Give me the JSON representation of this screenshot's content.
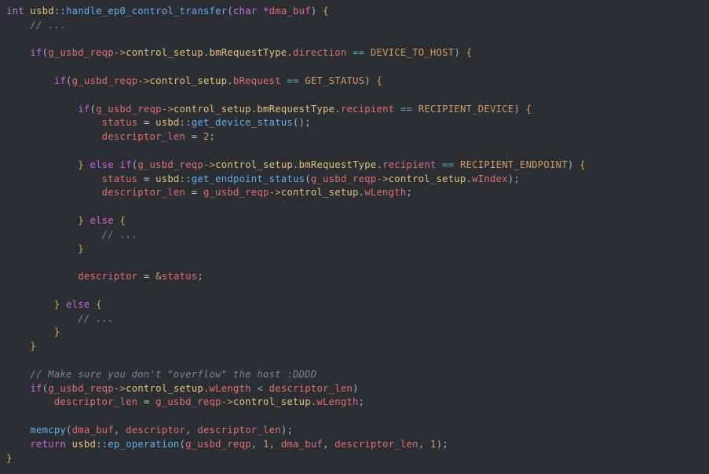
{
  "code": {
    "lines": [
      [
        {
          "t": "int",
          "c": "kw-type"
        },
        {
          "t": " ",
          "c": "op"
        },
        {
          "t": "usbd",
          "c": "ns"
        },
        {
          "t": "::",
          "c": "punct"
        },
        {
          "t": "handle_ep0_control_transfer",
          "c": "fn"
        },
        {
          "t": "(",
          "c": "punct"
        },
        {
          "t": "char",
          "c": "kw-type"
        },
        {
          "t": " ",
          "c": "op"
        },
        {
          "t": "*",
          "c": "op-star"
        },
        {
          "t": "dma_buf",
          "c": "param"
        },
        {
          "t": ")",
          "c": "punct"
        },
        {
          "t": " ",
          "c": "op"
        },
        {
          "t": "{",
          "c": "brace"
        }
      ],
      [
        {
          "t": "    ",
          "c": "op"
        },
        {
          "t": "// ...",
          "c": "comment"
        }
      ],
      [
        {
          "t": "",
          "c": "op"
        }
      ],
      [
        {
          "t": "    ",
          "c": "op"
        },
        {
          "t": "if",
          "c": "kw-ctrl"
        },
        {
          "t": "(",
          "c": "punct"
        },
        {
          "t": "g_usbd_reqp",
          "c": "var"
        },
        {
          "t": "->",
          "c": "op-arrow"
        },
        {
          "t": "control_setup",
          "c": "field"
        },
        {
          "t": ".",
          "c": "punct"
        },
        {
          "t": "bmRequestType",
          "c": "field"
        },
        {
          "t": ".",
          "c": "punct"
        },
        {
          "t": "direction",
          "c": "leaf"
        },
        {
          "t": " ",
          "c": "op"
        },
        {
          "t": "==",
          "c": "op-cmp"
        },
        {
          "t": " ",
          "c": "op"
        },
        {
          "t": "DEVICE_TO_HOST",
          "c": "const"
        },
        {
          "t": ")",
          "c": "punct"
        },
        {
          "t": " ",
          "c": "op"
        },
        {
          "t": "{",
          "c": "brace"
        }
      ],
      [
        {
          "t": "",
          "c": "op"
        }
      ],
      [
        {
          "t": "        ",
          "c": "op"
        },
        {
          "t": "if",
          "c": "kw-ctrl"
        },
        {
          "t": "(",
          "c": "punct"
        },
        {
          "t": "g_usbd_reqp",
          "c": "var"
        },
        {
          "t": "->",
          "c": "op-arrow"
        },
        {
          "t": "control_setup",
          "c": "field"
        },
        {
          "t": ".",
          "c": "punct"
        },
        {
          "t": "bRequest",
          "c": "leaf"
        },
        {
          "t": " ",
          "c": "op"
        },
        {
          "t": "==",
          "c": "op-cmp"
        },
        {
          "t": " ",
          "c": "op"
        },
        {
          "t": "GET_STATUS",
          "c": "const"
        },
        {
          "t": ")",
          "c": "punct"
        },
        {
          "t": " ",
          "c": "op"
        },
        {
          "t": "{",
          "c": "brace"
        }
      ],
      [
        {
          "t": "",
          "c": "op"
        }
      ],
      [
        {
          "t": "            ",
          "c": "op"
        },
        {
          "t": "if",
          "c": "kw-ctrl"
        },
        {
          "t": "(",
          "c": "punct"
        },
        {
          "t": "g_usbd_reqp",
          "c": "var"
        },
        {
          "t": "->",
          "c": "op-arrow"
        },
        {
          "t": "control_setup",
          "c": "field"
        },
        {
          "t": ".",
          "c": "punct"
        },
        {
          "t": "bmRequestType",
          "c": "field"
        },
        {
          "t": ".",
          "c": "punct"
        },
        {
          "t": "recipient",
          "c": "leaf"
        },
        {
          "t": " ",
          "c": "op"
        },
        {
          "t": "==",
          "c": "op-cmp"
        },
        {
          "t": " ",
          "c": "op"
        },
        {
          "t": "RECIPIENT_DEVICE",
          "c": "const"
        },
        {
          "t": ")",
          "c": "punct"
        },
        {
          "t": " ",
          "c": "op"
        },
        {
          "t": "{",
          "c": "brace"
        }
      ],
      [
        {
          "t": "                ",
          "c": "op"
        },
        {
          "t": "status",
          "c": "var"
        },
        {
          "t": " ",
          "c": "op"
        },
        {
          "t": "=",
          "c": "op-assign"
        },
        {
          "t": " ",
          "c": "op"
        },
        {
          "t": "usbd",
          "c": "ns"
        },
        {
          "t": "::",
          "c": "punct"
        },
        {
          "t": "get_device_status",
          "c": "fn"
        },
        {
          "t": "()",
          "c": "punct"
        },
        {
          "t": ";",
          "c": "punct"
        }
      ],
      [
        {
          "t": "                ",
          "c": "op"
        },
        {
          "t": "descriptor_len",
          "c": "var"
        },
        {
          "t": " ",
          "c": "op"
        },
        {
          "t": "=",
          "c": "op-assign"
        },
        {
          "t": " ",
          "c": "op"
        },
        {
          "t": "2",
          "c": "num"
        },
        {
          "t": ";",
          "c": "punct"
        }
      ],
      [
        {
          "t": "",
          "c": "op"
        }
      ],
      [
        {
          "t": "            ",
          "c": "op"
        },
        {
          "t": "}",
          "c": "brace"
        },
        {
          "t": " ",
          "c": "op"
        },
        {
          "t": "else",
          "c": "kw-ctrl"
        },
        {
          "t": " ",
          "c": "op"
        },
        {
          "t": "if",
          "c": "kw-ctrl"
        },
        {
          "t": "(",
          "c": "punct"
        },
        {
          "t": "g_usbd_reqp",
          "c": "var"
        },
        {
          "t": "->",
          "c": "op-arrow"
        },
        {
          "t": "control_setup",
          "c": "field"
        },
        {
          "t": ".",
          "c": "punct"
        },
        {
          "t": "bmRequestType",
          "c": "field"
        },
        {
          "t": ".",
          "c": "punct"
        },
        {
          "t": "recipient",
          "c": "leaf"
        },
        {
          "t": " ",
          "c": "op"
        },
        {
          "t": "==",
          "c": "op-cmp"
        },
        {
          "t": " ",
          "c": "op"
        },
        {
          "t": "RECIPIENT_ENDPOINT",
          "c": "const"
        },
        {
          "t": ")",
          "c": "punct"
        },
        {
          "t": " ",
          "c": "op"
        },
        {
          "t": "{",
          "c": "brace"
        }
      ],
      [
        {
          "t": "                ",
          "c": "op"
        },
        {
          "t": "status",
          "c": "var"
        },
        {
          "t": " ",
          "c": "op"
        },
        {
          "t": "=",
          "c": "op-assign"
        },
        {
          "t": " ",
          "c": "op"
        },
        {
          "t": "usbd",
          "c": "ns"
        },
        {
          "t": "::",
          "c": "punct"
        },
        {
          "t": "get_endpoint_status",
          "c": "fn"
        },
        {
          "t": "(",
          "c": "punct"
        },
        {
          "t": "g_usbd_reqp",
          "c": "var"
        },
        {
          "t": "->",
          "c": "op-arrow"
        },
        {
          "t": "control_setup",
          "c": "field"
        },
        {
          "t": ".",
          "c": "punct"
        },
        {
          "t": "wIndex",
          "c": "leaf"
        },
        {
          "t": ")",
          "c": "punct"
        },
        {
          "t": ";",
          "c": "punct"
        }
      ],
      [
        {
          "t": "                ",
          "c": "op"
        },
        {
          "t": "descriptor_len",
          "c": "var"
        },
        {
          "t": " ",
          "c": "op"
        },
        {
          "t": "=",
          "c": "op-assign"
        },
        {
          "t": " ",
          "c": "op"
        },
        {
          "t": "g_usbd_reqp",
          "c": "var"
        },
        {
          "t": "->",
          "c": "op-arrow"
        },
        {
          "t": "control_setup",
          "c": "field"
        },
        {
          "t": ".",
          "c": "punct"
        },
        {
          "t": "wLength",
          "c": "leaf"
        },
        {
          "t": ";",
          "c": "punct"
        }
      ],
      [
        {
          "t": "",
          "c": "op"
        }
      ],
      [
        {
          "t": "            ",
          "c": "op"
        },
        {
          "t": "}",
          "c": "brace"
        },
        {
          "t": " ",
          "c": "op"
        },
        {
          "t": "else",
          "c": "kw-ctrl"
        },
        {
          "t": " ",
          "c": "op"
        },
        {
          "t": "{",
          "c": "brace"
        }
      ],
      [
        {
          "t": "                ",
          "c": "op"
        },
        {
          "t": "// ...",
          "c": "comment"
        }
      ],
      [
        {
          "t": "            ",
          "c": "op"
        },
        {
          "t": "}",
          "c": "brace"
        }
      ],
      [
        {
          "t": "",
          "c": "op"
        }
      ],
      [
        {
          "t": "            ",
          "c": "op"
        },
        {
          "t": "descriptor",
          "c": "var"
        },
        {
          "t": " ",
          "c": "op"
        },
        {
          "t": "=",
          "c": "op-assign"
        },
        {
          "t": " ",
          "c": "op"
        },
        {
          "t": "&",
          "c": "op-amp"
        },
        {
          "t": "status",
          "c": "var"
        },
        {
          "t": ";",
          "c": "punct"
        }
      ],
      [
        {
          "t": "",
          "c": "op"
        }
      ],
      [
        {
          "t": "        ",
          "c": "op"
        },
        {
          "t": "}",
          "c": "brace"
        },
        {
          "t": " ",
          "c": "op"
        },
        {
          "t": "else",
          "c": "kw-ctrl"
        },
        {
          "t": " ",
          "c": "op"
        },
        {
          "t": "{",
          "c": "brace"
        }
      ],
      [
        {
          "t": "            ",
          "c": "op"
        },
        {
          "t": "// ...",
          "c": "comment"
        }
      ],
      [
        {
          "t": "        ",
          "c": "op"
        },
        {
          "t": "}",
          "c": "brace"
        }
      ],
      [
        {
          "t": "    ",
          "c": "op"
        },
        {
          "t": "}",
          "c": "brace"
        }
      ],
      [
        {
          "t": "",
          "c": "op"
        }
      ],
      [
        {
          "t": "    ",
          "c": "op"
        },
        {
          "t": "// Make sure you don't \"overflow\" the host :DDDD",
          "c": "comment"
        }
      ],
      [
        {
          "t": "    ",
          "c": "op"
        },
        {
          "t": "if",
          "c": "kw-ctrl"
        },
        {
          "t": "(",
          "c": "punct"
        },
        {
          "t": "g_usbd_reqp",
          "c": "var"
        },
        {
          "t": "->",
          "c": "op-arrow"
        },
        {
          "t": "control_setup",
          "c": "field"
        },
        {
          "t": ".",
          "c": "punct"
        },
        {
          "t": "wLength",
          "c": "leaf"
        },
        {
          "t": " ",
          "c": "op"
        },
        {
          "t": "<",
          "c": "op-cmp"
        },
        {
          "t": " ",
          "c": "op"
        },
        {
          "t": "descriptor_len",
          "c": "var"
        },
        {
          "t": ")",
          "c": "punct"
        }
      ],
      [
        {
          "t": "        ",
          "c": "op"
        },
        {
          "t": "descriptor_len",
          "c": "var"
        },
        {
          "t": " ",
          "c": "op"
        },
        {
          "t": "=",
          "c": "op-assign"
        },
        {
          "t": " ",
          "c": "op"
        },
        {
          "t": "g_usbd_reqp",
          "c": "var"
        },
        {
          "t": "->",
          "c": "op-arrow"
        },
        {
          "t": "control_setup",
          "c": "field"
        },
        {
          "t": ".",
          "c": "punct"
        },
        {
          "t": "wLength",
          "c": "leaf"
        },
        {
          "t": ";",
          "c": "punct"
        }
      ],
      [
        {
          "t": "",
          "c": "op"
        }
      ],
      [
        {
          "t": "    ",
          "c": "op"
        },
        {
          "t": "memcpy",
          "c": "fn"
        },
        {
          "t": "(",
          "c": "punct"
        },
        {
          "t": "dma_buf",
          "c": "var"
        },
        {
          "t": ", ",
          "c": "punct"
        },
        {
          "t": "descriptor",
          "c": "var"
        },
        {
          "t": ", ",
          "c": "punct"
        },
        {
          "t": "descriptor_len",
          "c": "var"
        },
        {
          "t": ")",
          "c": "punct"
        },
        {
          "t": ";",
          "c": "punct"
        }
      ],
      [
        {
          "t": "    ",
          "c": "op"
        },
        {
          "t": "return",
          "c": "kw-ctrl"
        },
        {
          "t": " ",
          "c": "op"
        },
        {
          "t": "usbd",
          "c": "ns"
        },
        {
          "t": "::",
          "c": "punct"
        },
        {
          "t": "ep_operation",
          "c": "fn"
        },
        {
          "t": "(",
          "c": "punct"
        },
        {
          "t": "g_usbd_reqp",
          "c": "var"
        },
        {
          "t": ", ",
          "c": "punct"
        },
        {
          "t": "1",
          "c": "num"
        },
        {
          "t": ", ",
          "c": "punct"
        },
        {
          "t": "dma_buf",
          "c": "var"
        },
        {
          "t": ", ",
          "c": "punct"
        },
        {
          "t": "descriptor_len",
          "c": "var"
        },
        {
          "t": ", ",
          "c": "punct"
        },
        {
          "t": "1",
          "c": "num"
        },
        {
          "t": ")",
          "c": "punct"
        },
        {
          "t": ";",
          "c": "punct"
        }
      ],
      [
        {
          "t": "}",
          "c": "brace"
        }
      ]
    ]
  }
}
